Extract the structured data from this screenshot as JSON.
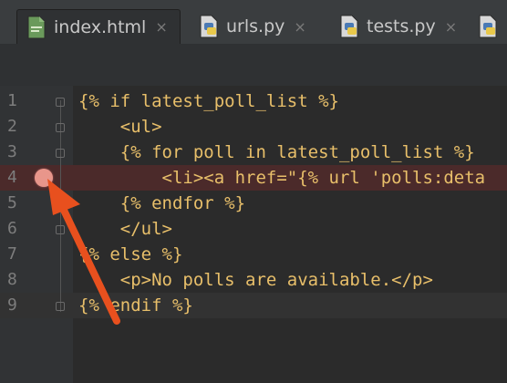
{
  "tabs": [
    {
      "label": "index.html",
      "close": "×",
      "icon": "html-file-icon",
      "active": true
    },
    {
      "label": "urls.py",
      "close": "×",
      "icon": "python-file-icon",
      "active": false
    },
    {
      "label": "tests.py",
      "close": "×",
      "icon": "python-file-icon",
      "active": false
    }
  ],
  "lines": [
    {
      "num": "1",
      "text": "{% if latest_poll_list %}"
    },
    {
      "num": "2",
      "text": "    <ul>"
    },
    {
      "num": "3",
      "text": "    {% for poll in latest_poll_list %}"
    },
    {
      "num": "4",
      "text": "        <li><a href=\"{% url 'polls:deta"
    },
    {
      "num": "5",
      "text": "    {% endfor %}"
    },
    {
      "num": "6",
      "text": "    </ul>"
    },
    {
      "num": "7",
      "text": "{% else %}"
    },
    {
      "num": "8",
      "text": "    <p>No polls are available.</p>"
    },
    {
      "num": "9",
      "text": "{% endif %}"
    }
  ],
  "breakpoint_line": "4",
  "colors": {
    "breakpoint": "#e8968b",
    "arrow": "#e8501e",
    "background": "#2b2b2b"
  }
}
